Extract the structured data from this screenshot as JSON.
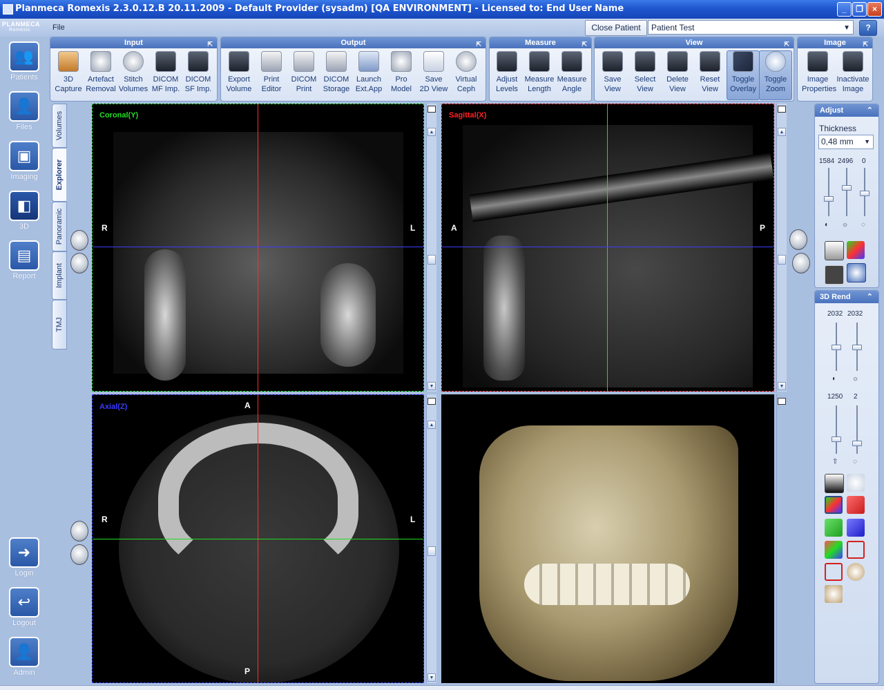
{
  "window": {
    "title": "Planmeca Romexis 2.3.0.12.B  20.11.2009 - Default Provider (sysadm) [QA ENVIRONMENT] - Licensed to: End User Name"
  },
  "logo": {
    "line1": "PLANMECA",
    "line2": "Romexis"
  },
  "menu": {
    "file": "File"
  },
  "patient": {
    "close_label": "Close Patient",
    "selected": "Patient Test",
    "help": "?"
  },
  "nav": {
    "patients": "Patients",
    "files": "Files",
    "imaging": "Imaging",
    "three_d": "3D",
    "report": "Report",
    "login": "Login",
    "logout": "Logout",
    "admin": "Admin"
  },
  "ribbon": {
    "input": {
      "title": "Input",
      "buttons": [
        {
          "l1": "3D",
          "l2": "Capture"
        },
        {
          "l1": "Artefact",
          "l2": "Removal"
        },
        {
          "l1": "Stitch",
          "l2": "Volumes"
        },
        {
          "l1": "DICOM",
          "l2": "MF Imp."
        },
        {
          "l1": "DICOM",
          "l2": "SF Imp."
        }
      ]
    },
    "output": {
      "title": "Output",
      "buttons": [
        {
          "l1": "Export",
          "l2": "Volume"
        },
        {
          "l1": "Print",
          "l2": "Editor"
        },
        {
          "l1": "DICOM",
          "l2": "Print"
        },
        {
          "l1": "DICOM",
          "l2": "Storage"
        },
        {
          "l1": "Launch",
          "l2": "Ext.App"
        },
        {
          "l1": "Pro",
          "l2": "Model"
        },
        {
          "l1": "Save",
          "l2": "2D View"
        },
        {
          "l1": "Virtual",
          "l2": "Ceph"
        }
      ]
    },
    "measure": {
      "title": "Measure",
      "buttons": [
        {
          "l1": "Adjust",
          "l2": "Levels"
        },
        {
          "l1": "Measure",
          "l2": "Length"
        },
        {
          "l1": "Measure",
          "l2": "Angle"
        }
      ]
    },
    "view": {
      "title": "View",
      "buttons": [
        {
          "l1": "Save",
          "l2": "View"
        },
        {
          "l1": "Select",
          "l2": "View"
        },
        {
          "l1": "Delete",
          "l2": "View"
        },
        {
          "l1": "Reset",
          "l2": "View"
        },
        {
          "l1": "Toggle",
          "l2": "Overlay"
        },
        {
          "l1": "Toggle",
          "l2": "Zoom"
        }
      ]
    },
    "image": {
      "title": "Image",
      "buttons": [
        {
          "l1": "Image",
          "l2": "Properties"
        },
        {
          "l1": "Inactivate",
          "l2": "Image"
        }
      ]
    }
  },
  "tabs": [
    "Volumes",
    "Explorer",
    "Panoramic",
    "Implant",
    "TMJ"
  ],
  "views": {
    "coronal": {
      "label": "Coronal(Y)",
      "left": "R",
      "right": "L"
    },
    "sagittal": {
      "label": "Sagittal(X)",
      "left": "A",
      "right": "P"
    },
    "axial": {
      "label": "Axial(Z)",
      "left": "R",
      "right": "L",
      "top": "A",
      "bottom": "P"
    }
  },
  "adjust": {
    "title": "Adjust",
    "thickness_label": "Thickness",
    "thickness_value": "0,48 mm",
    "values": [
      "1584",
      "2496",
      "0"
    ]
  },
  "rend3d": {
    "title": "3D Rend",
    "values_top": [
      "2032",
      "2032"
    ],
    "values_bottom": [
      "1250",
      "2"
    ]
  },
  "colors": {
    "coronal_label": "#22dd22",
    "sagittal_label": "#ff2222",
    "axial_label": "#3a3aff",
    "crosshair_red": "#ff3030",
    "crosshair_blue": "#3c3cff",
    "crosshair_green": "#22dd22",
    "ribbon_header": "#4a72bd"
  }
}
